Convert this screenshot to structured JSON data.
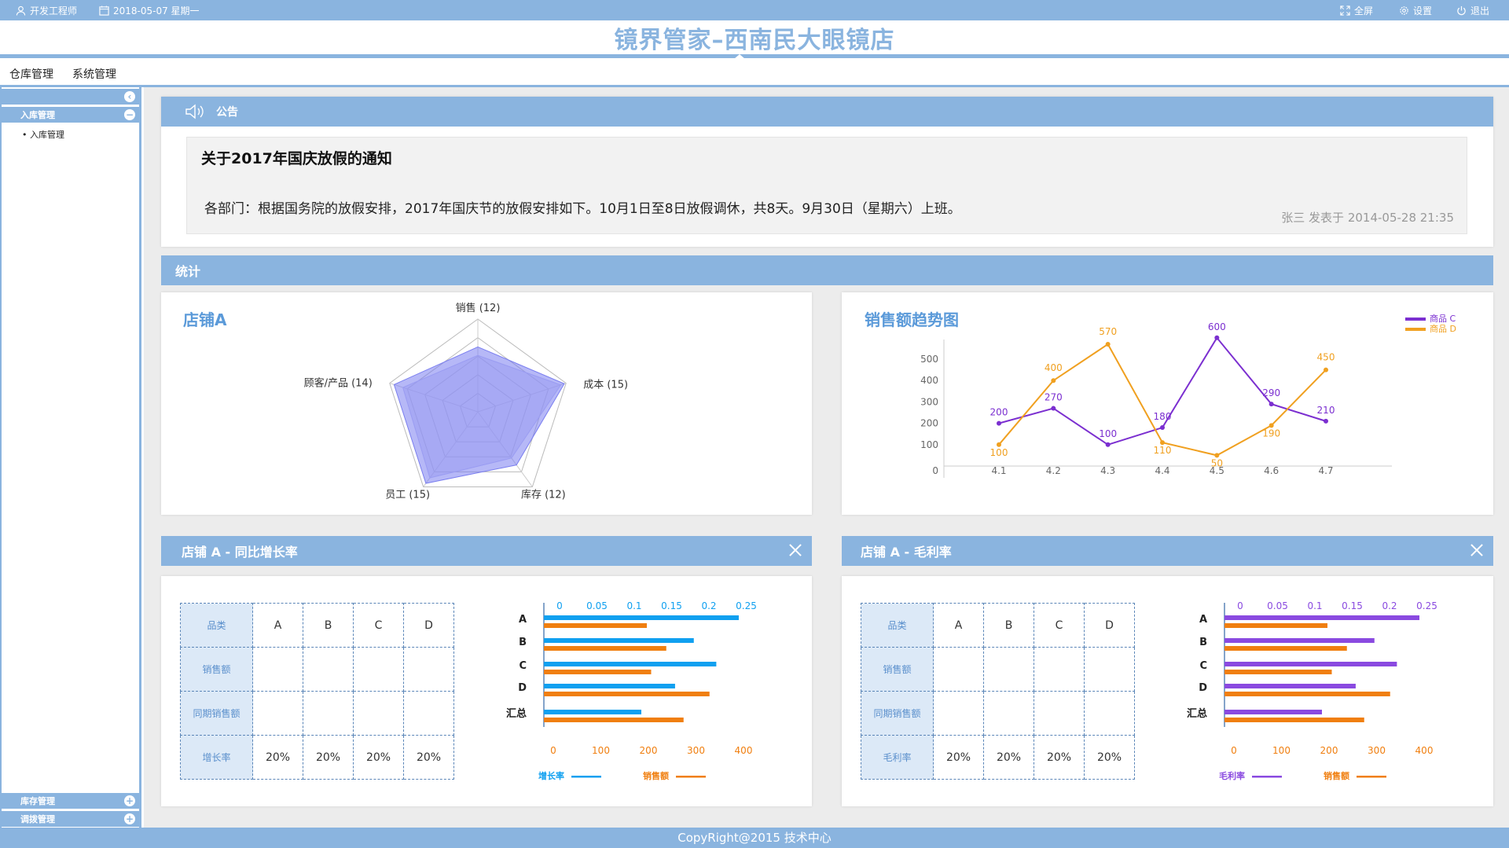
{
  "topbar": {
    "user": "开发工程师",
    "date": "2018-05-07 星期一",
    "fullscreen": "全屏",
    "settings": "设置",
    "logout": "退出"
  },
  "app_title": "镜界管家–西南民大眼镜店",
  "menu": {
    "warehouse": "仓库管理",
    "system": "系统管理"
  },
  "sidebar": {
    "inbound_group": "入库管理",
    "inbound_item": "入库管理",
    "stock_group": "库存管理",
    "transfer_group": "调拨管理"
  },
  "notice": {
    "header": "公告",
    "title": "关于2017年国庆放假的通知",
    "body": "各部门：根据国务院的放假安排，2017年国庆节的放假安排如下。10月1日至8日放假调休，共8天。9月30日（星期六）上班。",
    "meta": "张三 发表于 2014-05-28 21:35"
  },
  "stats": {
    "header": "统计"
  },
  "chart_data": [
    {
      "type": "radar",
      "title": "店铺A",
      "indicators": [
        {
          "name": "销售",
          "max": 12,
          "label": "销售 (12)"
        },
        {
          "name": "成本",
          "max": 15,
          "label": "成本 (15)"
        },
        {
          "name": "库存",
          "max": 12,
          "label": "库存 (12)"
        },
        {
          "name": "员工",
          "max": 15,
          "label": "员工 (15)"
        },
        {
          "name": "顾客/产品",
          "max": 14,
          "label": "顾客/产品 (14)"
        }
      ],
      "series": [
        {
          "values": [
            8.4,
            14.7,
            8.5,
            14.3,
            13.3
          ]
        },
        {
          "values": [
            7.3,
            14.1,
            7.4,
            13.2,
            11.9
          ]
        }
      ],
      "colors": [
        "#7a7ef0",
        "#9a9cf2"
      ]
    },
    {
      "type": "line",
      "title": "销售额趋势图",
      "x": [
        "4.1",
        "4.2",
        "4.3",
        "4.4",
        "4.5",
        "4.6",
        "4.7"
      ],
      "ylim": [
        0,
        500
      ],
      "yticks": [
        0,
        100,
        200,
        300,
        400,
        500
      ],
      "series": [
        {
          "name": "商品 C",
          "color": "#7b2fd0",
          "values": [
            200,
            270,
            100,
            180,
            600,
            290,
            210
          ]
        },
        {
          "name": "商品 D",
          "color": "#f0a020",
          "values": [
            100,
            400,
            570,
            110,
            50,
            190,
            450
          ]
        }
      ]
    },
    {
      "type": "bar",
      "title": "店铺 A - 同比增长率",
      "categories": [
        "A",
        "B",
        "C",
        "D",
        "汇总"
      ],
      "x_top": {
        "ticks": [
          "0",
          "0.05",
          "0.1",
          "0.15",
          "0.2",
          "0.25"
        ],
        "max": 0.25
      },
      "x_bottom": {
        "ticks": [
          "0",
          "100",
          "200",
          "300",
          "400"
        ],
        "max": 400
      },
      "series": [
        {
          "name": "增长率",
          "color": "#10a0f0",
          "axis": "top",
          "values": [
            0.26,
            0.2,
            0.23,
            0.175,
            0.13
          ]
        },
        {
          "name": "销售额",
          "color": "#f07f10",
          "axis": "bottom",
          "values": [
            220,
            265,
            230,
            365,
            305
          ]
        }
      ]
    },
    {
      "type": "bar",
      "title": "店铺 A - 毛利率",
      "categories": [
        "A",
        "B",
        "C",
        "D",
        "汇总"
      ],
      "x_top": {
        "ticks": [
          "0",
          "0.05",
          "0.1",
          "0.15",
          "0.2",
          "0.25"
        ],
        "max": 0.25
      },
      "x_bottom": {
        "ticks": [
          "0",
          "100",
          "200",
          "300",
          "400"
        ],
        "max": 400
      },
      "series": [
        {
          "name": "毛利率",
          "color": "#8a4ae0",
          "axis": "top",
          "values": [
            0.26,
            0.2,
            0.23,
            0.175,
            0.13
          ]
        },
        {
          "name": "销售额",
          "color": "#f07f10",
          "axis": "bottom",
          "values": [
            220,
            265,
            230,
            365,
            305
          ]
        }
      ]
    }
  ],
  "table_growth": {
    "header": [
      "品类",
      "A",
      "B",
      "C",
      "D"
    ],
    "rows": [
      [
        "销售额",
        "",
        "",
        "",
        ""
      ],
      [
        "同期销售额",
        "",
        "",
        "",
        ""
      ],
      [
        "增长率",
        "20%",
        "20%",
        "20%",
        "20%"
      ]
    ]
  },
  "table_margin": {
    "header": [
      "品类",
      "A",
      "B",
      "C",
      "D"
    ],
    "rows": [
      [
        "销售额",
        "",
        "",
        "",
        ""
      ],
      [
        "同期销售额",
        "",
        "",
        "",
        ""
      ],
      [
        "毛利率",
        "20%",
        "20%",
        "20%",
        "20%"
      ]
    ]
  },
  "footer": "CopyRight@2015 技术中心"
}
